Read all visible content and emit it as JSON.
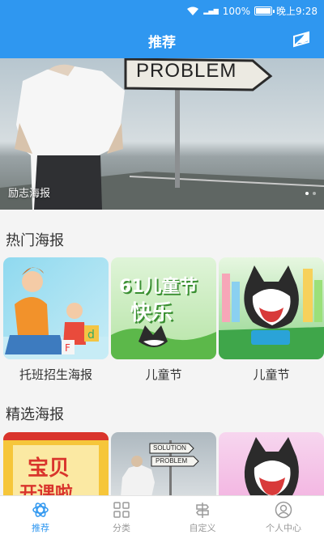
{
  "status_bar": {
    "battery": "100%",
    "time": "晚上9:28",
    "battery_level": 1.0
  },
  "header": {
    "title": "推荐"
  },
  "banner": {
    "sign_text": "PROBLEM",
    "caption": "励志海报"
  },
  "hot": {
    "title": "热门海报",
    "items": [
      {
        "label": "托班招生海报"
      },
      {
        "label": "儿童节",
        "art_text_1": "61儿童节",
        "art_text_2": "快乐"
      },
      {
        "label": "儿童节"
      }
    ]
  },
  "featured": {
    "title": "精选海报",
    "items": [
      {
        "art_text_1": "宝贝",
        "art_text_2": "开课啦"
      },
      {
        "art_text_1": "SOLUTION",
        "art_text_2": "PROBLEM"
      },
      {
        "art_text_1": ""
      }
    ]
  },
  "tabbar": {
    "items": [
      {
        "label": "推荐",
        "icon": "atom-icon"
      },
      {
        "label": "分类",
        "icon": "grid-icon"
      },
      {
        "label": "自定义",
        "icon": "signpost-icon"
      },
      {
        "label": "个人中心",
        "icon": "user-icon"
      }
    ]
  },
  "colors": {
    "accent": "#2f97f0",
    "tab_inactive": "#9a9a9a"
  }
}
